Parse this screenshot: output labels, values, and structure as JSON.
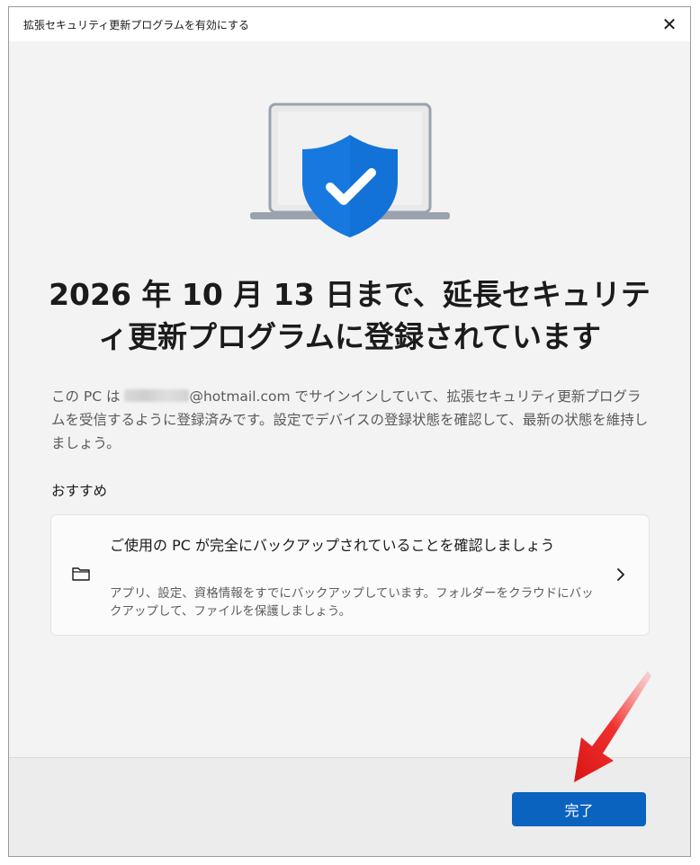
{
  "window": {
    "title": "拡張セキュリティ更新プログラムを有効にする",
    "close_glyph": "✕"
  },
  "hero": {
    "icon": "laptop-shield-check-icon",
    "shield_color": "#1272d8"
  },
  "headline": "2026 年 10 月 13 日まで、延長セキュリティ更新プログラムに登録されています",
  "description": {
    "prefix": "この PC は ",
    "email_suffix": "@hotmail.com",
    "suffix": " でサインインしていて、拡張セキュリティ更新プログラムを受信するように登録済みです。設定でデバイスの登録状態を確認して、最新の状態を維持しましょう。"
  },
  "recommended": {
    "label": "おすすめ",
    "card": {
      "icon": "folder-icon",
      "title": "ご使用の PC が完全にバックアップされていることを確認しましょう",
      "description": "アプリ、設定、資格情報をすでにバックアップしています。フォルダーをクラウドにバックアップして、ファイルを保護しましょう。",
      "chevron": "chevron-right-icon"
    }
  },
  "footer": {
    "done_label": "完了"
  },
  "colors": {
    "accent": "#0b63c0",
    "annotation_arrow": "#e8201f"
  }
}
